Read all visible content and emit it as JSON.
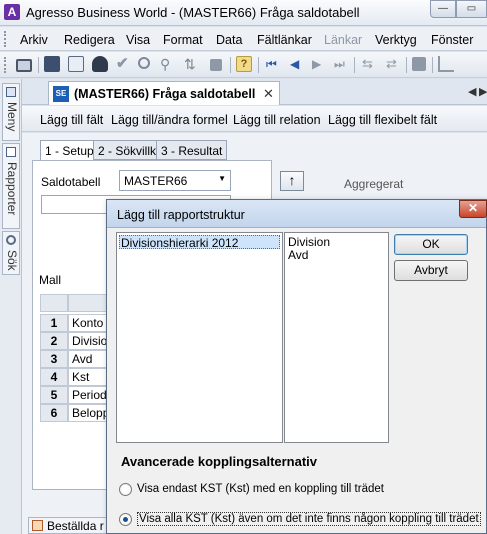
{
  "app": {
    "logo_letter": "A",
    "title": "Agresso Business World - (MASTER66) Fråga saldotabell",
    "min_glyph": "—",
    "max_glyph": "▭"
  },
  "menu": {
    "items": [
      "Arkiv",
      "Redigera",
      "Visa",
      "Format",
      "Data",
      "Fältlänkar",
      "Länkar",
      "Verktyg",
      "Fönster"
    ]
  },
  "toolbar": {
    "icons": [
      "print-icon",
      "save-icon",
      "copy-icon",
      "find-icon",
      "check-icon",
      "zoom-icon",
      "filter-icon",
      "sort-icon",
      "stop-icon",
      "help-icon",
      "first-record-icon",
      "previous-record-icon",
      "next-record-icon",
      "last-record-icon",
      "split-icon",
      "merge-icon",
      "grid-icon",
      "chart-icon"
    ]
  },
  "siderail": {
    "tabs": [
      "Meny",
      "Rapporter",
      "Sök"
    ]
  },
  "document_tab": {
    "icon_label": "SE",
    "title": "(MASTER66) Fråga saldotabell",
    "close_glyph": "✕",
    "nav_prev": "◀",
    "nav_next": "▶"
  },
  "actions": {
    "items": [
      "Lägg till fält",
      "Lägg till/ändra formel",
      "Lägg till relation",
      "Lägg till flexibelt fält"
    ]
  },
  "subtabs": {
    "items": [
      "1 - Setup",
      "2 - Sökvillk",
      "3 - Resultat"
    ]
  },
  "setup": {
    "saldotabell_label": "Saldotabell",
    "saldotabell_value": "MASTER66",
    "mall_label": "Mall",
    "aggregerat_label": "Aggregerat",
    "up_glyph": "↑",
    "rows": [
      {
        "num": "1",
        "name": "Konto"
      },
      {
        "num": "2",
        "name": "Division"
      },
      {
        "num": "3",
        "name": "Avd"
      },
      {
        "num": "4",
        "name": "Kst"
      },
      {
        "num": "5",
        "name": "Period"
      },
      {
        "num": "6",
        "name": "Belopp"
      }
    ],
    "bottom_tab": "Beställda r"
  },
  "dialog": {
    "title": "Lägg till rapportstruktur",
    "close_glyph": "✕",
    "left_list": [
      "Divisionshierarki 2012"
    ],
    "right_list": [
      "Division",
      "Avd"
    ],
    "ok_label": "OK",
    "cancel_label": "Avbryt",
    "section_heading": "Avancerade kopplingsalternativ",
    "radio_options": [
      {
        "label": "Visa endast KST (Kst) med en koppling till trädet",
        "checked": false
      },
      {
        "label": "Visa alla KST (Kst) även om det inte finns någon koppling till trädet",
        "checked": true
      }
    ]
  }
}
